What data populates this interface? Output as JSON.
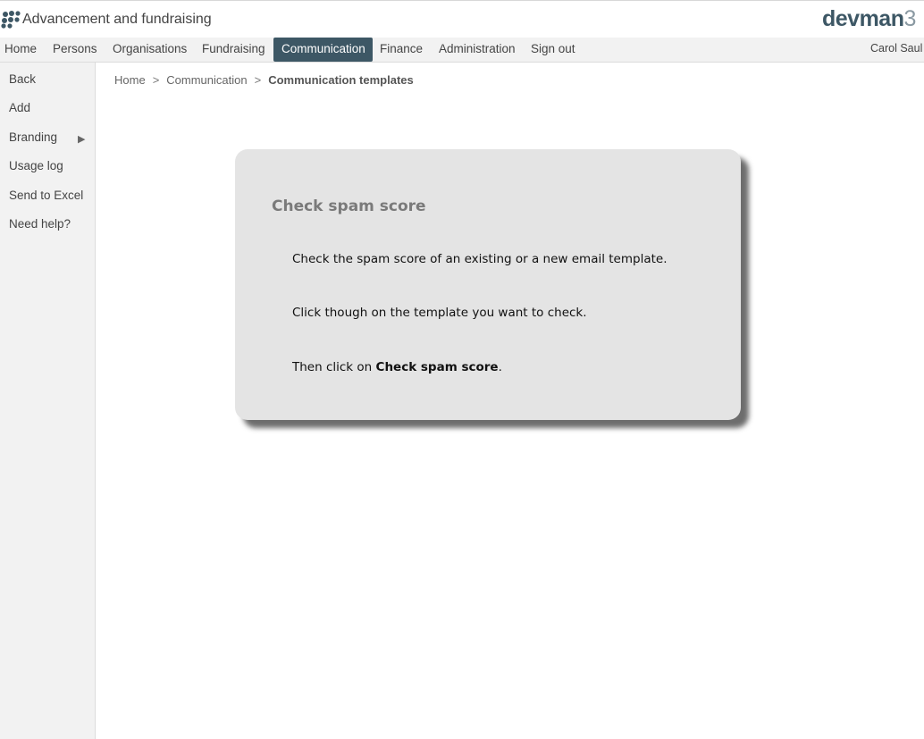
{
  "app": {
    "title": "Advancement and fundraising",
    "brand": "devman",
    "brand_suffix": "3"
  },
  "nav": {
    "items": [
      "Home",
      "Persons",
      "Organisations",
      "Fundraising",
      "Communication",
      "Finance",
      "Administration",
      "Sign out"
    ],
    "active": "Communication",
    "user": "Carol Saul"
  },
  "sidebar": {
    "items": [
      "Back",
      "Add",
      "Branding",
      "Usage log",
      "Send to Excel",
      "Need help?"
    ],
    "branding_arrow": "▶"
  },
  "breadcrumb": {
    "items": [
      "Home",
      "Communication"
    ],
    "separator": ">",
    "current": "Communication templates"
  },
  "info": {
    "title": "Check spam score",
    "line1": "Check the spam score of an existing or a new email template.",
    "line2": "Click though on the template you want to check.",
    "line3_prefix": "Then click on ",
    "line3_bold": "Check spam score",
    "line3_suffix": "."
  },
  "colors": {
    "accent": "#3d5765",
    "sidebar_bg": "#f2f2f2",
    "infobox_bg": "#e4e4e4"
  }
}
